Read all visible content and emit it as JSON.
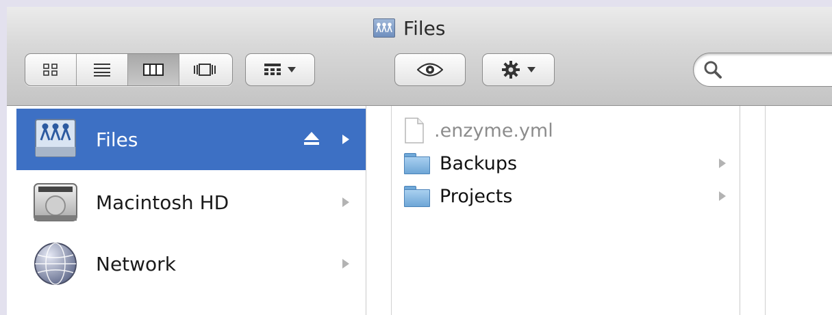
{
  "window": {
    "title": "Files"
  },
  "toolbar": {
    "view_buttons": [
      {
        "name": "icon-view"
      },
      {
        "name": "list-view"
      },
      {
        "name": "column-view",
        "active": true
      },
      {
        "name": "cover-flow-view"
      }
    ]
  },
  "sidebar": {
    "items": [
      {
        "label": "Files",
        "icon": "network-share-icon",
        "selected": true,
        "eject": true
      },
      {
        "label": "Macintosh HD",
        "icon": "hard-drive-icon",
        "selected": false
      },
      {
        "label": "Network",
        "icon": "globe-icon",
        "selected": false
      }
    ]
  },
  "column": {
    "items": [
      {
        "label": ".enzyme.yml",
        "icon": "document-icon",
        "dimmed": true,
        "has_children": false
      },
      {
        "label": "Backups",
        "icon": "folder-icon",
        "dimmed": false,
        "has_children": true
      },
      {
        "label": "Projects",
        "icon": "folder-icon",
        "dimmed": false,
        "has_children": true
      }
    ]
  },
  "colors": {
    "selection": "#3d70c4",
    "background": "#e3e1ee"
  }
}
